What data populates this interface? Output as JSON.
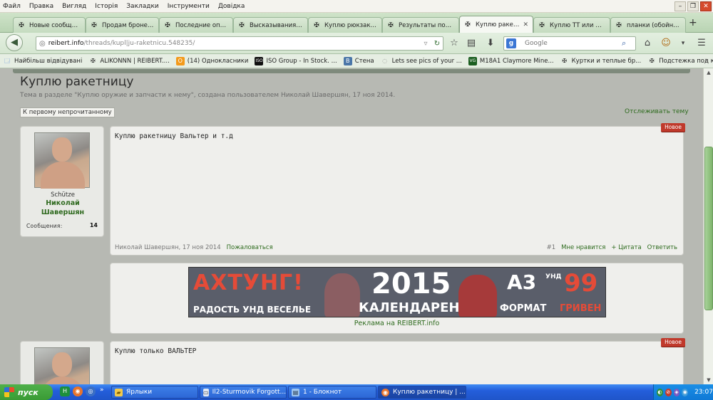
{
  "menu": [
    "Файл",
    "Правка",
    "Вигляд",
    "Історія",
    "Закладки",
    "Інструменти",
    "Довідка"
  ],
  "tabs": [
    {
      "title": "Новые сообщен...",
      "icon": "✠"
    },
    {
      "title": "Продам бронежи...",
      "icon": "✠"
    },
    {
      "title": "Последние опов...",
      "icon": "✠"
    },
    {
      "title": "Высказывания ф...",
      "icon": "✠"
    },
    {
      "title": "Куплю рюкзак ...",
      "icon": "✠"
    },
    {
      "title": "Результаты пои...",
      "icon": "✠"
    },
    {
      "title": "Куплю ракет...",
      "icon": "✠",
      "active": true
    },
    {
      "title": "Куплю ТТ или Н...",
      "icon": "✠"
    },
    {
      "title": "планки (обойны)...",
      "icon": "✠"
    }
  ],
  "nav": {
    "url_domain": "reibert.info",
    "url_path": "/threads/kupl|ju-raketnicu.548235/",
    "search_placeholder": "Google"
  },
  "bookmarks": [
    {
      "label": "Найбільш відвідувані",
      "icon": "🗔",
      "color": "#5c8ed6"
    },
    {
      "label": "ALIKONNN | REIBERT....",
      "icon": "✠",
      "color": "#ffffff"
    },
    {
      "label": "(14) Однокласники",
      "icon": "О",
      "color": "#f39a1b"
    },
    {
      "label": "ISO Group - In Stock. ...",
      "icon": "ISO",
      "color": "#111111"
    },
    {
      "label": "Стена",
      "icon": "В",
      "color": "#4a76a8"
    },
    {
      "label": "Lets see pics of your ...",
      "icon": "◌",
      "color": "#ffffff"
    },
    {
      "label": "M18A1 Claymore Mine...",
      "icon": "VG",
      "color": "#1b5e20"
    },
    {
      "label": "Куртки и теплые бр...",
      "icon": "✠",
      "color": "#ffffff"
    },
    {
      "label": "Подстежка под курт...",
      "icon": "✠",
      "color": "#ffffff"
    }
  ],
  "thread": {
    "title": "Куплю ракетницу",
    "description": "Тема в разделе \"Куплю оружие и запчасти к нему\", создана пользователем Николай Шавершян, 17 ноя 2014.",
    "first_unread": "К первому непрочитанному",
    "watch": "Отслеживать тему"
  },
  "posts": [
    {
      "rank": "Schütze",
      "username_line1": "Николай",
      "username_line2": "Шавершян",
      "stat_label": "Сообщения:",
      "stat_value": "14",
      "text": "Куплю ракетницу Вальтер и т.д",
      "badge": "Новое",
      "author_date": "Николай Шавершян, 17 ноя 2014",
      "report": "Пожаловаться",
      "number": "#1",
      "like": "Мне нравится",
      "quote": "+ Цитата",
      "reply": "Ответить"
    },
    {
      "text": "Куплю только ВАЛЬТЕР",
      "badge": "Новое"
    }
  ],
  "ad": {
    "line1": "АХТУНГ!",
    "line2": "РАДОСТЬ УНД ВЕСЕЛЬЕ",
    "year": "2015",
    "calendar": "КАЛЕНДАРЕН",
    "a3": "А3",
    "und": "УНД",
    "price": "99",
    "format": "ФОРМАТ",
    "currency": "ГРИВЕН",
    "link": "Реклама на REIBERT.info"
  },
  "taskbar": {
    "start": "пуск",
    "tasks": [
      {
        "label": "Ярлыки",
        "icon": "📁",
        "color": "#f2c94c"
      },
      {
        "label": "Il2-Sturmovik Forgott...",
        "icon": "▭",
        "color": "#dfe8f5"
      },
      {
        "label": "1 - Блокнот",
        "icon": "▤",
        "color": "#9ec5f0"
      },
      {
        "label": "Куплю ракетницу | ...",
        "icon": "◉",
        "color": "#e8742b",
        "active": true
      }
    ],
    "clock": "23:07"
  }
}
